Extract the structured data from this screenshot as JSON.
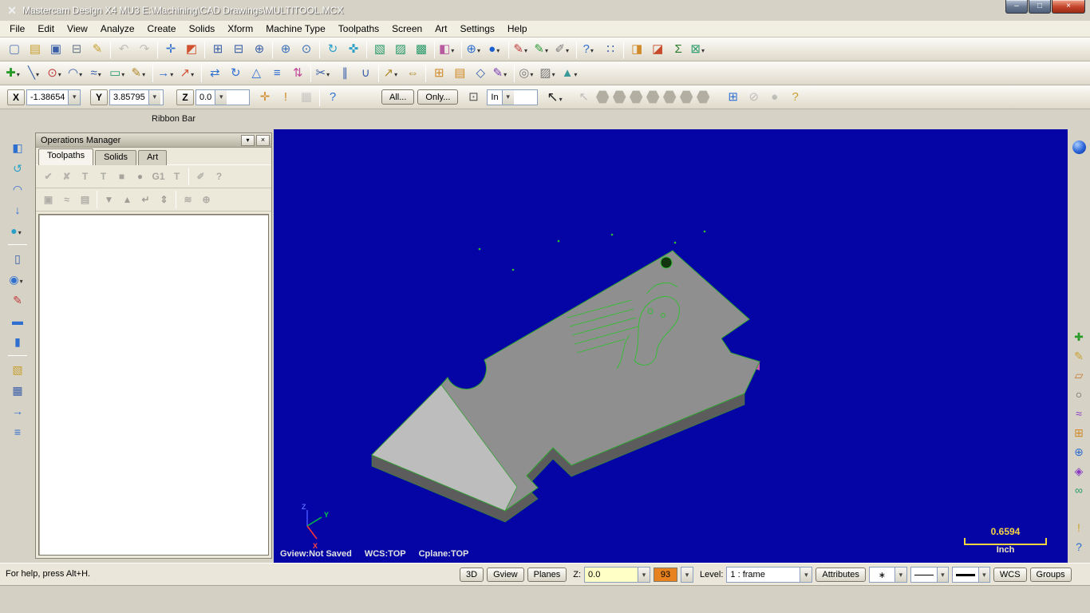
{
  "colors": {
    "titlebar": "#6e1a10",
    "viewport_bg": "#0505a6",
    "part_fill": "#8f8f8f",
    "part_side": "#5c5c5c",
    "blade_fill": "#bdbdbd",
    "wireframe_green": "#2fbf2f",
    "scale_yellow": "#f5d442",
    "swatch_orange": "#e8821e",
    "z_field_yellow": "#ffffc6"
  },
  "window": {
    "title": "Mastercam Design X4 MU3  E:\\Machining\\CAD Drawings\\MULTITOOL.MCX",
    "logo_glyph": "✕",
    "buttons": {
      "minimize": "–",
      "maximize": "□",
      "close": "×"
    }
  },
  "menu": {
    "items": [
      {
        "name": "menu-file",
        "label": "File"
      },
      {
        "name": "menu-edit",
        "label": "Edit"
      },
      {
        "name": "menu-view",
        "label": "View"
      },
      {
        "name": "menu-analyze",
        "label": "Analyze"
      },
      {
        "name": "menu-create",
        "label": "Create"
      },
      {
        "name": "menu-solids",
        "label": "Solids"
      },
      {
        "name": "menu-xform",
        "label": "Xform"
      },
      {
        "name": "menu-machine-type",
        "label": "Machine Type"
      },
      {
        "name": "menu-toolpaths",
        "label": "Toolpaths"
      },
      {
        "name": "menu-screen",
        "label": "Screen"
      },
      {
        "name": "menu-art",
        "label": "Art"
      },
      {
        "name": "menu-settings",
        "label": "Settings"
      },
      {
        "name": "menu-help",
        "label": "Help"
      }
    ]
  },
  "toolbar1": {
    "icons": [
      {
        "name": "new-file-icon",
        "glyph": "▢",
        "color": "#5a7ab5"
      },
      {
        "name": "open-file-icon",
        "glyph": "▤",
        "color": "#c8a030"
      },
      {
        "name": "save-file-icon",
        "glyph": "▣",
        "color": "#3a5fa8"
      },
      {
        "name": "print-icon",
        "glyph": "⊟",
        "color": "#6a7a8a"
      },
      {
        "name": "file-converters-icon",
        "glyph": "✎",
        "color": "#c8a030"
      },
      {
        "type": "sep"
      },
      {
        "name": "undo-icon",
        "glyph": "↶",
        "color": "#888",
        "disabled": true
      },
      {
        "name": "redo-icon",
        "glyph": "↷",
        "color": "#888",
        "disabled": true
      },
      {
        "type": "sep"
      },
      {
        "name": "delete-entities-icon",
        "glyph": "✛",
        "color": "#2f6fd0"
      },
      {
        "name": "undelete-entities-icon",
        "glyph": "◩",
        "color": "#d05030"
      },
      {
        "type": "sep"
      },
      {
        "name": "zoom-window-icon",
        "glyph": "⊞",
        "color": "#3a5fa8"
      },
      {
        "name": "unzoom-icon",
        "glyph": "⊟",
        "color": "#3a5fa8"
      },
      {
        "name": "zoom-target-icon",
        "glyph": "⊕",
        "color": "#3a5fa8"
      },
      {
        "type": "sep"
      },
      {
        "name": "zoom-in-icon",
        "glyph": "⊕",
        "color": "#3a6fb8"
      },
      {
        "name": "zoom-fit-icon",
        "glyph": "⊙",
        "color": "#3a6fb8"
      },
      {
        "type": "sep"
      },
      {
        "name": "dynamic-rotation-icon",
        "glyph": "↻",
        "color": "#2aa0c8"
      },
      {
        "name": "pan-icon",
        "glyph": "✜",
        "color": "#2aa0c8"
      },
      {
        "type": "sep"
      },
      {
        "name": "gview-top-icon",
        "glyph": "▧",
        "color": "#2a9a6a"
      },
      {
        "name": "gview-front-icon",
        "glyph": "▨",
        "color": "#2a9a6a"
      },
      {
        "name": "gview-isometric-icon",
        "glyph": "▩",
        "color": "#2a9a6a"
      },
      {
        "type": "sep"
      },
      {
        "name": "shading-settings-icon",
        "glyph": "◧",
        "color": "#b85aa0",
        "dropdown": true
      },
      {
        "type": "sep"
      },
      {
        "name": "planes-globe-icon",
        "glyph": "⊕",
        "color": "#2f6fd0",
        "dropdown": true
      },
      {
        "name": "wcs-sphere-icon",
        "glyph": "●",
        "color": "#1a5fd0",
        "dropdown": true
      },
      {
        "type": "sep"
      },
      {
        "name": "color-attribute-icon",
        "glyph": "✎",
        "color": "#c03a3a",
        "dropdown": true
      },
      {
        "name": "level-attribute-icon",
        "glyph": "✎",
        "color": "#2a9a3a",
        "dropdown": true
      },
      {
        "name": "style-attribute-icon",
        "glyph": "✐",
        "color": "#777",
        "dropdown": true
      },
      {
        "type": "sep"
      },
      {
        "name": "help-icon",
        "glyph": "?",
        "color": "#2f6fd0",
        "dropdown": true
      },
      {
        "name": "grid-settings-icon",
        "glyph": "∷",
        "color": "#3a5fa8"
      },
      {
        "type": "sep"
      },
      {
        "name": "multithread-manager-icon",
        "glyph": "◨",
        "color": "#d08a2a"
      },
      {
        "name": "machine-sim-icon",
        "glyph": "◪",
        "color": "#c84a2a"
      },
      {
        "name": "sigma-icon",
        "glyph": "Σ",
        "color": "#2a7a2a"
      },
      {
        "name": "exit-design-icon",
        "glyph": "⊠",
        "color": "#2a9a6a",
        "dropdown": true
      }
    ]
  },
  "toolbar2": {
    "icons": [
      {
        "name": "create-point-icon",
        "glyph": "✚",
        "color": "#2a9a2a",
        "dropdown": true
      },
      {
        "name": "create-line-icon",
        "glyph": "╲",
        "color": "#3a5fa8",
        "dropdown": true
      },
      {
        "name": "create-circle-icon",
        "glyph": "⊙",
        "color": "#c04040",
        "dropdown": true
      },
      {
        "name": "create-fillet-icon",
        "glyph": "◠",
        "color": "#3a5fa8",
        "dropdown": true
      },
      {
        "name": "create-spline-icon",
        "glyph": "≈",
        "color": "#3a5fa8",
        "dropdown": true
      },
      {
        "name": "create-rectangle-icon",
        "glyph": "▭",
        "color": "#2a9a6a",
        "dropdown": true
      },
      {
        "name": "create-drafting-icon",
        "glyph": "✎",
        "color": "#b08a2a",
        "dropdown": true
      },
      {
        "type": "sep"
      },
      {
        "name": "xform-translate-icon",
        "glyph": "→",
        "color": "#2f6fd0",
        "dropdown": true
      },
      {
        "name": "xform-translate-3d-icon",
        "glyph": "↗",
        "color": "#d05030",
        "dropdown": true
      },
      {
        "type": "sep"
      },
      {
        "name": "xform-mirror-icon",
        "glyph": "⇄",
        "color": "#2f6fd0"
      },
      {
        "name": "xform-rotate-icon",
        "glyph": "↻",
        "color": "#2f6fd0"
      },
      {
        "name": "xform-scale-icon",
        "glyph": "△",
        "color": "#2f6fd0"
      },
      {
        "name": "xform-offset-icon",
        "glyph": "≡",
        "color": "#2f6fd0"
      },
      {
        "name": "xform-project-icon",
        "glyph": "⇅",
        "color": "#c04a9a"
      },
      {
        "type": "sep"
      },
      {
        "name": "trim-break-icon",
        "glyph": "✂",
        "color": "#3a5fa8",
        "dropdown": true
      },
      {
        "name": "break-divide-icon",
        "glyph": "∥",
        "color": "#3a5fa8"
      },
      {
        "name": "join-entities-icon",
        "glyph": "∪",
        "color": "#3a5fa8"
      },
      {
        "type": "sep"
      },
      {
        "name": "analyze-position-icon",
        "glyph": "↗",
        "color": "#b08a2a",
        "dropdown": true
      },
      {
        "name": "analyze-distance-icon",
        "glyph": "⇔",
        "color": "#b08a2a"
      },
      {
        "type": "sep"
      },
      {
        "name": "screen-grid-icon",
        "glyph": "⊞",
        "color": "#d08a2a"
      },
      {
        "name": "hide-entities-icon",
        "glyph": "▤",
        "color": "#d08a2a"
      },
      {
        "name": "blank-entity-icon",
        "glyph": "◇",
        "color": "#3a5fa8"
      },
      {
        "name": "set-attributes-icon",
        "glyph": "✎",
        "color": "#7a3ab0",
        "dropdown": true
      },
      {
        "type": "sep"
      },
      {
        "name": "display-shaded-icon",
        "glyph": "◎",
        "color": "#777",
        "dropdown": true
      },
      {
        "name": "display-wireframe-icon",
        "glyph": "▨",
        "color": "#777",
        "dropdown": true
      },
      {
        "name": "surface-display-icon",
        "glyph": "▲",
        "color": "#3a9a9a",
        "dropdown": true
      }
    ]
  },
  "ribbon": {
    "caption": "Ribbon Bar",
    "x_label": "X",
    "x_value": "-1.38654",
    "y_label": "Y",
    "y_value": "3.85795",
    "z_label": "Z",
    "z_value": "0.0",
    "all_button": "All...",
    "only_button": "Only...",
    "in_value": "In",
    "icons_mid": [
      {
        "name": "fastpoint-icon",
        "glyph": "✛",
        "color": "#d08a2a"
      },
      {
        "name": "autocursor-alert-icon",
        "glyph": "!",
        "color": "#d08a2a"
      },
      {
        "name": "autocursor-config-icon",
        "glyph": "▦",
        "color": "#999",
        "disabled": true
      },
      {
        "type": "sep"
      },
      {
        "name": "autocursor-help-icon",
        "glyph": "?",
        "color": "#2f6fd0"
      }
    ],
    "pre_in_icons": [
      {
        "name": "selection-grid-icon",
        "glyph": "⊡",
        "color": "#555"
      }
    ],
    "hexagons": [
      {
        "name": "select-arrow-disabled-icon",
        "glyph": "↖",
        "color": "#8a8878",
        "disabled": true
      },
      {
        "name": "select-chain-hex",
        "shape": "hex"
      },
      {
        "name": "select-window-hex",
        "shape": "hex"
      },
      {
        "name": "select-polygon-hex",
        "shape": "hex"
      },
      {
        "name": "select-single-hex",
        "shape": "hex"
      },
      {
        "name": "select-area-hex",
        "shape": "hex"
      },
      {
        "name": "select-vector-hex",
        "shape": "hex"
      },
      {
        "name": "select-group-hex",
        "shape": "hex"
      }
    ],
    "right_icons": [
      {
        "name": "selection-verify-icon",
        "glyph": "⊞",
        "color": "#2f6fd0"
      },
      {
        "name": "selection-none-icon",
        "glyph": "⊘",
        "color": "#888",
        "disabled": true
      },
      {
        "name": "selection-sphere-icon",
        "glyph": "●",
        "color": "#888",
        "disabled": true
      },
      {
        "name": "selection-help-icon",
        "glyph": "?",
        "color": "#c8a030"
      }
    ]
  },
  "left_toolbar": {
    "icons": [
      {
        "name": "bookmark-view-icon",
        "glyph": "◧",
        "color": "#2f6fd0"
      },
      {
        "name": "regen-view-icon",
        "glyph": "↺",
        "color": "#2aa0c8"
      },
      {
        "name": "arc-edit-icon",
        "glyph": "◠",
        "color": "#2f6fd0"
      },
      {
        "name": "arrow-down-icon",
        "glyph": "↓",
        "color": "#2f6fd0"
      },
      {
        "name": "sphere-view-icon",
        "glyph": "●",
        "color": "#2aa0c8",
        "dropdown": true
      },
      {
        "type": "sep"
      },
      {
        "name": "window-view-icon",
        "glyph": "▯",
        "color": "#3a5fa8"
      },
      {
        "name": "cylinder-icon",
        "glyph": "◉",
        "color": "#2f6fd0",
        "dropdown": true
      },
      {
        "name": "red-pencil-icon",
        "glyph": "✎",
        "color": "#c03a3a"
      },
      {
        "name": "dash-tool-icon",
        "glyph": "▬",
        "color": "#2f6fd0"
      },
      {
        "name": "panel-tool-icon",
        "glyph": "▮",
        "color": "#2f6fd0"
      },
      {
        "type": "sep"
      },
      {
        "name": "yellow-box-icon",
        "glyph": "▧",
        "color": "#c8a030"
      },
      {
        "name": "grid-box-icon",
        "glyph": "▦",
        "color": "#3a5fa8"
      },
      {
        "name": "arrow-right-icon",
        "glyph": "→",
        "color": "#2f6fd0"
      },
      {
        "name": "layers-icon",
        "glyph": "≡",
        "color": "#2f6fd0"
      }
    ]
  },
  "right_toolbar": {
    "icons": [
      {
        "name": "add-point-icon",
        "glyph": "✚",
        "color": "#2a9a2a"
      },
      {
        "name": "sketch-pencil-icon",
        "glyph": "✎",
        "color": "#c8a030"
      },
      {
        "name": "erase-icon",
        "glyph": "▱",
        "color": "#c87a30"
      },
      {
        "name": "circle-select-icon",
        "glyph": "○",
        "color": "#555"
      },
      {
        "name": "purple-curve-icon",
        "glyph": "≈",
        "color": "#8a3ac0"
      },
      {
        "name": "art-grid-icon",
        "glyph": "⊞",
        "color": "#d08a2a"
      },
      {
        "name": "globe-icon",
        "glyph": "⊕",
        "color": "#2f6fd0"
      },
      {
        "name": "gem-icon",
        "glyph": "◈",
        "color": "#8a3ac0"
      },
      {
        "name": "chain-icon",
        "glyph": "∞",
        "color": "#2a9a6a"
      }
    ],
    "bottom_icons": [
      {
        "name": "alert-icon",
        "glyph": "!",
        "color": "#d0a030"
      },
      {
        "name": "context-help-icon",
        "glyph": "?",
        "color": "#2f6fd0"
      }
    ]
  },
  "operations_manager": {
    "title": "Operations Manager",
    "close_glyph": "×",
    "tabs": [
      {
        "name": "tab-toolpaths",
        "label": "Toolpaths",
        "active": true
      },
      {
        "name": "tab-solids",
        "label": "Solids"
      },
      {
        "name": "tab-art",
        "label": "Art"
      }
    ],
    "toolbar_top": [
      {
        "name": "select-all-ops-icon",
        "glyph": "✔",
        "color": "#3a8a5a",
        "disabled": true
      },
      {
        "name": "deselect-all-ops-icon",
        "glyph": "✘",
        "color": "#3a8a5a",
        "disabled": true
      },
      {
        "name": "regen-all-params-icon",
        "glyph": "T",
        "color": "#3a6a9a",
        "disabled": true
      },
      {
        "name": "regen-selected-icon",
        "glyph": "T",
        "color": "#3a6a9a",
        "disabled": true
      },
      {
        "name": "backplot-icon",
        "glyph": "■",
        "color": "#555",
        "disabled": true
      },
      {
        "name": "verify-icon",
        "glyph": "●",
        "color": "#444",
        "disabled": true
      },
      {
        "name": "post-g1-icon",
        "glyph": "G1",
        "color": "#555",
        "disabled": true
      },
      {
        "name": "highfeed-icon",
        "glyph": "T",
        "color": "#3a6a9a",
        "disabled": true
      },
      {
        "type": "sep"
      },
      {
        "name": "edit-ops-icon",
        "glyph": "✐",
        "color": "#777",
        "disabled": true
      },
      {
        "name": "om-help-icon",
        "glyph": "?",
        "color": "#3a6a9a",
        "disabled": true
      }
    ],
    "toolbar_bottom": [
      {
        "name": "lock-ops-icon",
        "glyph": "▣",
        "color": "#666",
        "disabled": true
      },
      {
        "name": "toolpath-display-icon",
        "glyph": "≈",
        "color": "#666",
        "disabled": true
      },
      {
        "name": "posting-toggle-icon",
        "glyph": "▤",
        "color": "#666",
        "disabled": true
      },
      {
        "type": "sep"
      },
      {
        "name": "move-down-icon",
        "glyph": "▼",
        "color": "#445",
        "disabled": true
      },
      {
        "name": "move-up-icon",
        "glyph": "▲",
        "color": "#445",
        "disabled": true
      },
      {
        "name": "insert-arrow-icon",
        "glyph": "↵",
        "color": "#445",
        "disabled": true
      },
      {
        "name": "scroll-ops-icon",
        "glyph": "⇕",
        "color": "#445",
        "disabled": true
      },
      {
        "type": "sep"
      },
      {
        "name": "ghost-ops-icon",
        "glyph": "≋",
        "color": "#666",
        "disabled": true
      },
      {
        "name": "assoc-ops-icon",
        "glyph": "⊕",
        "color": "#666",
        "disabled": true
      }
    ]
  },
  "viewport": {
    "gview_status": "Gview:Not Saved",
    "wcs_status": "WCS:TOP",
    "cplane_status": "Cplane:TOP",
    "scale": {
      "value": "0.6594",
      "unit": "Inch"
    },
    "axis_labels": {
      "x": "X",
      "y": "Y",
      "z": "Z"
    }
  },
  "statusbar": {
    "help_text": "For help, press Alt+H.",
    "buttons_3d": "3D",
    "gview": "Gview",
    "planes": "Planes",
    "z_label": "Z:",
    "z_value": "0.0",
    "color_value": "93",
    "level_label": "Level:",
    "level_value": "1 : frame",
    "attributes": "Attributes",
    "point_style": "∗",
    "wcs": "WCS",
    "groups": "Groups"
  }
}
